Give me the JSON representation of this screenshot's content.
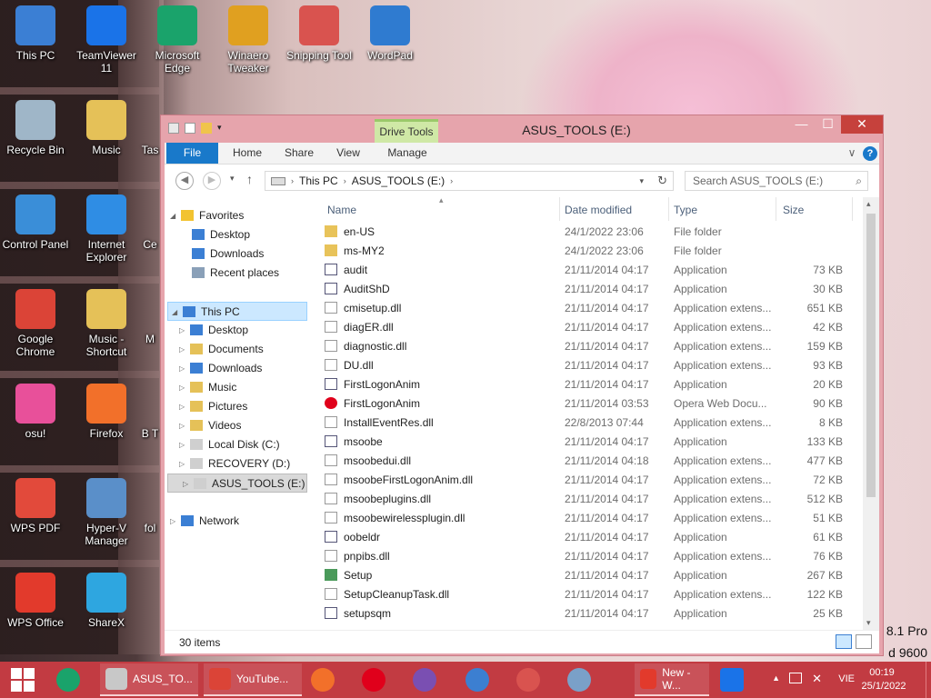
{
  "desktop": {
    "icons": [
      {
        "label": "This PC",
        "name": "this-pc-icon",
        "color": "#3b7fd4"
      },
      {
        "label": "TeamViewer 11",
        "name": "teamviewer-icon",
        "color": "#1a73e8"
      },
      {
        "label": "Microsoft Edge",
        "name": "edge-icon",
        "color": "#1aa36b"
      },
      {
        "label": "Winaero Tweaker",
        "name": "winaero-tweaker-icon",
        "color": "#e0a020"
      },
      {
        "label": "Snipping Tool",
        "name": "snipping-tool-icon",
        "color": "#d9534f"
      },
      {
        "label": "WordPad",
        "name": "wordpad-icon",
        "color": "#2f7bd0"
      },
      {
        "label": "Recycle Bin",
        "name": "recycle-bin-icon",
        "color": "#9fb6c8"
      },
      {
        "label": "Music",
        "name": "music-folder-icon",
        "color": "#e5c158"
      },
      {
        "label": "Tas",
        "name": "task-icon",
        "color": "#888888"
      },
      {
        "label": "Control Panel",
        "name": "control-panel-icon",
        "color": "#3a8ed8"
      },
      {
        "label": "Internet Explorer",
        "name": "internet-explorer-icon",
        "color": "#2f8de4"
      },
      {
        "label": "Ce",
        "name": "ce-icon",
        "color": "#888888"
      },
      {
        "label": "Google Chrome",
        "name": "chrome-icon",
        "color": "#db4437"
      },
      {
        "label": "Music - Shortcut",
        "name": "music-shortcut-icon",
        "color": "#e5c158"
      },
      {
        "label": "M",
        "name": "m-icon",
        "color": "#888888"
      },
      {
        "label": "osu!",
        "name": "osu-icon",
        "color": "#e8509a"
      },
      {
        "label": "Firefox",
        "name": "firefox-icon",
        "color": "#f2702a"
      },
      {
        "label": "B T",
        "name": "b-icon",
        "color": "#888888"
      },
      {
        "label": "WPS PDF",
        "name": "wps-pdf-icon",
        "color": "#e24a3b"
      },
      {
        "label": "Hyper-V Manager",
        "name": "hyper-v-icon",
        "color": "#5a8fc9"
      },
      {
        "label": "fol",
        "name": "folder-icon",
        "color": "#888888"
      },
      {
        "label": "WPS Office",
        "name": "wps-office-icon",
        "color": "#e23a2c"
      },
      {
        "label": "ShareX",
        "name": "sharex-icon",
        "color": "#2ea6e0"
      }
    ],
    "watermark_line1": "8.1 Pro",
    "watermark_line2": "d 9600"
  },
  "window": {
    "title": "ASUS_TOOLS (E:)",
    "contextual_tab": "Drive Tools",
    "minimize": "—",
    "maximize": "☐",
    "close": "✕",
    "ribbon_tabs": [
      "File",
      "Home",
      "Share",
      "View",
      "Manage"
    ],
    "help": "?",
    "expand": "∨",
    "breadcrumb": [
      "This PC",
      "ASUS_TOOLS (E:)"
    ],
    "search_placeholder": "Search ASUS_TOOLS (E:)",
    "status": "30 items"
  },
  "nav": {
    "favorites": "Favorites",
    "fav_items": [
      "Desktop",
      "Downloads",
      "Recent places"
    ],
    "this_pc": "This PC",
    "pc_items": [
      "Desktop",
      "Documents",
      "Downloads",
      "Music",
      "Pictures",
      "Videos",
      "Local Disk (C:)",
      "RECOVERY (D:)",
      "ASUS_TOOLS (E:)"
    ],
    "network": "Network"
  },
  "columns": {
    "name": "Name",
    "date": "Date modified",
    "type": "Type",
    "size": "Size"
  },
  "files": [
    {
      "name": "en-US",
      "date": "24/1/2022 23:06",
      "type": "File folder",
      "size": "",
      "kind": "folder"
    },
    {
      "name": "ms-MY2",
      "date": "24/1/2022 23:06",
      "type": "File folder",
      "size": "",
      "kind": "folder"
    },
    {
      "name": "audit",
      "date": "21/11/2014 04:17",
      "type": "Application",
      "size": "73 KB",
      "kind": "app"
    },
    {
      "name": "AuditShD",
      "date": "21/11/2014 04:17",
      "type": "Application",
      "size": "30 KB",
      "kind": "app"
    },
    {
      "name": "cmisetup.dll",
      "date": "21/11/2014 04:17",
      "type": "Application extens...",
      "size": "651 KB",
      "kind": "dll"
    },
    {
      "name": "diagER.dll",
      "date": "21/11/2014 04:17",
      "type": "Application extens...",
      "size": "42 KB",
      "kind": "dll"
    },
    {
      "name": "diagnostic.dll",
      "date": "21/11/2014 04:17",
      "type": "Application extens...",
      "size": "159 KB",
      "kind": "dll"
    },
    {
      "name": "DU.dll",
      "date": "21/11/2014 04:17",
      "type": "Application extens...",
      "size": "93 KB",
      "kind": "dll"
    },
    {
      "name": "FirstLogonAnim",
      "date": "21/11/2014 04:17",
      "type": "Application",
      "size": "20 KB",
      "kind": "app"
    },
    {
      "name": "FirstLogonAnim",
      "date": "21/11/2014 03:53",
      "type": "Opera Web Docu...",
      "size": "90 KB",
      "kind": "opera"
    },
    {
      "name": "InstallEventRes.dll",
      "date": "22/8/2013 07:44",
      "type": "Application extens...",
      "size": "8 KB",
      "kind": "dll"
    },
    {
      "name": "msoobe",
      "date": "21/11/2014 04:17",
      "type": "Application",
      "size": "133 KB",
      "kind": "app"
    },
    {
      "name": "msoobedui.dll",
      "date": "21/11/2014 04:18",
      "type": "Application extens...",
      "size": "477 KB",
      "kind": "dll"
    },
    {
      "name": "msoobeFirstLogonAnim.dll",
      "date": "21/11/2014 04:17",
      "type": "Application extens...",
      "size": "72 KB",
      "kind": "dll"
    },
    {
      "name": "msoobeplugins.dll",
      "date": "21/11/2014 04:17",
      "type": "Application extens...",
      "size": "512 KB",
      "kind": "dll"
    },
    {
      "name": "msoobewirelessplugin.dll",
      "date": "21/11/2014 04:17",
      "type": "Application extens...",
      "size": "51 KB",
      "kind": "dll"
    },
    {
      "name": "oobeldr",
      "date": "21/11/2014 04:17",
      "type": "Application",
      "size": "61 KB",
      "kind": "app"
    },
    {
      "name": "pnpibs.dll",
      "date": "21/11/2014 04:17",
      "type": "Application extens...",
      "size": "76 KB",
      "kind": "dll"
    },
    {
      "name": "Setup",
      "date": "21/11/2014 04:17",
      "type": "Application",
      "size": "267 KB",
      "kind": "setup"
    },
    {
      "name": "SetupCleanupTask.dll",
      "date": "21/11/2014 04:17",
      "type": "Application extens...",
      "size": "122 KB",
      "kind": "dll"
    },
    {
      "name": "setupsqm",
      "date": "21/11/2014 04:17",
      "type": "Application",
      "size": "25 KB",
      "kind": "app"
    }
  ],
  "taskbar": {
    "tasks": [
      {
        "label": "ASUS_TO...",
        "name": "taskbar-explorer",
        "color": "#c8c8c8"
      },
      {
        "label": "YouTube...",
        "name": "taskbar-chrome",
        "color": "#db4437"
      }
    ],
    "pinned": [
      {
        "name": "taskbar-firefox-icon",
        "color": "#f2702a"
      },
      {
        "name": "taskbar-opera-icon",
        "color": "#e0001b"
      },
      {
        "name": "taskbar-winrar-icon",
        "color": "#7a4fb2"
      },
      {
        "name": "taskbar-thunderbird-icon",
        "color": "#3c7fd1"
      },
      {
        "name": "taskbar-snipping-icon",
        "color": "#d9534f"
      },
      {
        "name": "taskbar-monitor-icon",
        "color": "#7aa0c8"
      }
    ],
    "wps_task": "New - W...",
    "language": "VIE",
    "time": "00:19",
    "date": "25/1/2022"
  }
}
